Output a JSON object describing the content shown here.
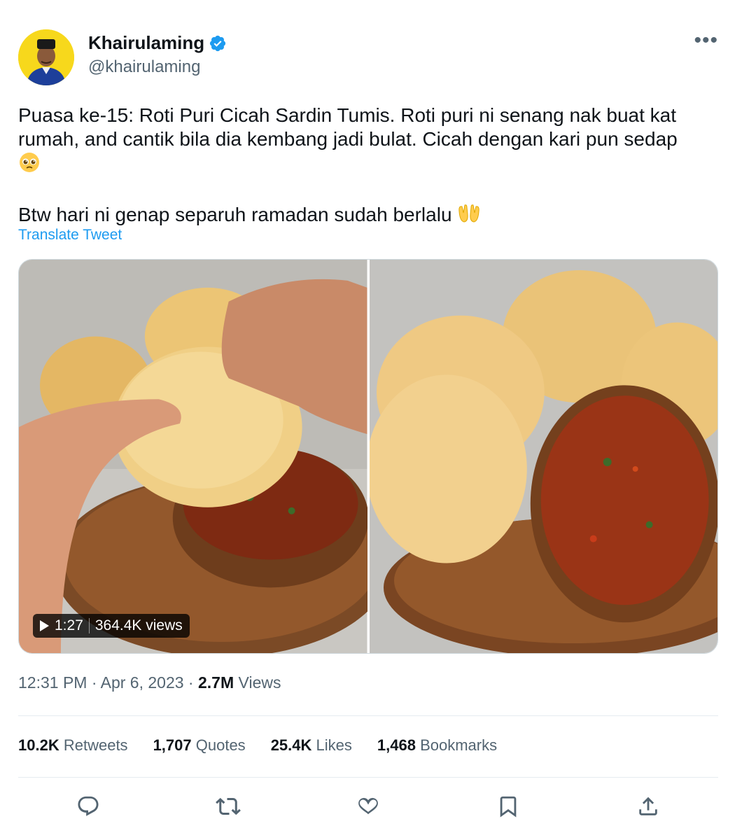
{
  "author": {
    "display_name": "Khairulaming",
    "handle": "@khairulaming",
    "verified": true
  },
  "tweet": {
    "paragraph1": "Puasa ke-15: Roti Puri Cicah Sardin Tumis. Roti puri ni senang nak buat kat rumah, and cantik bila dia kembang jadi bulat. Cicah dengan kari pun sedap",
    "paragraph2": "Btw hari ni genap separuh ramadan sudah berlalu",
    "translate_label": "Translate Tweet"
  },
  "media": {
    "video_duration": "1:27",
    "video_views": "364.4K views"
  },
  "meta": {
    "time": "12:31 PM",
    "date": "Apr 6, 2023",
    "views_count": "2.7M",
    "views_label": "Views"
  },
  "stats": {
    "retweets_count": "10.2K",
    "retweets_label": "Retweets",
    "quotes_count": "1,707",
    "quotes_label": "Quotes",
    "likes_count": "25.4K",
    "likes_label": "Likes",
    "bookmarks_count": "1,468",
    "bookmarks_label": "Bookmarks"
  },
  "icons": {
    "reply": "reply-icon",
    "retweet": "retweet-icon",
    "like": "heart-icon",
    "bookmark": "bookmark-icon",
    "share": "share-icon",
    "more": "more-icon"
  },
  "colors": {
    "accent": "#1d9bf0",
    "text": "#0f1419",
    "secondary": "#536471"
  }
}
